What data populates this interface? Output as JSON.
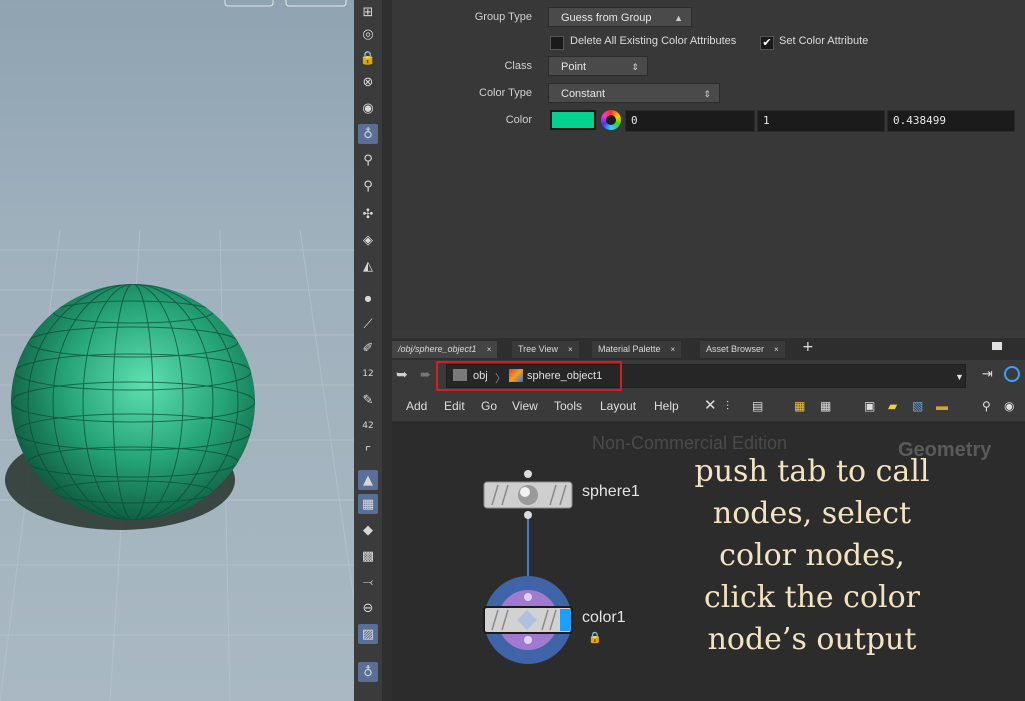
{
  "params": {
    "group_type_label": "Group Type",
    "group_type_value": "Guess from Group",
    "delete_attrs_label": "Delete All Existing Color Attributes",
    "set_color_attr_label": "Set Color Attribute",
    "set_color_attr_checked": true,
    "class_label": "Class",
    "class_value": "Point",
    "color_type_label": "Color Type",
    "color_type_value": "Constant",
    "color_label": "Color",
    "color_swatch": "#00d38f",
    "color_r": "0",
    "color_g": "1",
    "color_b": "0.438499"
  },
  "tabs": [
    {
      "label": "/obj/sphere_object1"
    },
    {
      "label": "Tree View"
    },
    {
      "label": "Material Palette"
    },
    {
      "label": "Asset Browser"
    }
  ],
  "tab_close": "×",
  "tab_add": "+",
  "path": {
    "crumb1": "obj",
    "crumb2": "sphere_object1"
  },
  "menubar": [
    "Add",
    "Edit",
    "Go",
    "View",
    "Tools",
    "Layout",
    "Help"
  ],
  "network": {
    "watermark": "Non-Commercial Edition",
    "context": "Geometry",
    "node1_name": "sphere1",
    "node2_name": "color1",
    "annotation": "push tab to call nodes, select color nodes, click the color node’s output"
  },
  "shelf_badges": {
    "twelve": "12",
    "forty_two": "42"
  },
  "colors": {
    "sphere": "#2aa77a",
    "node_ring": "#3f64a8",
    "node_inner": "#a07ad0",
    "highlight": "#d02020"
  }
}
